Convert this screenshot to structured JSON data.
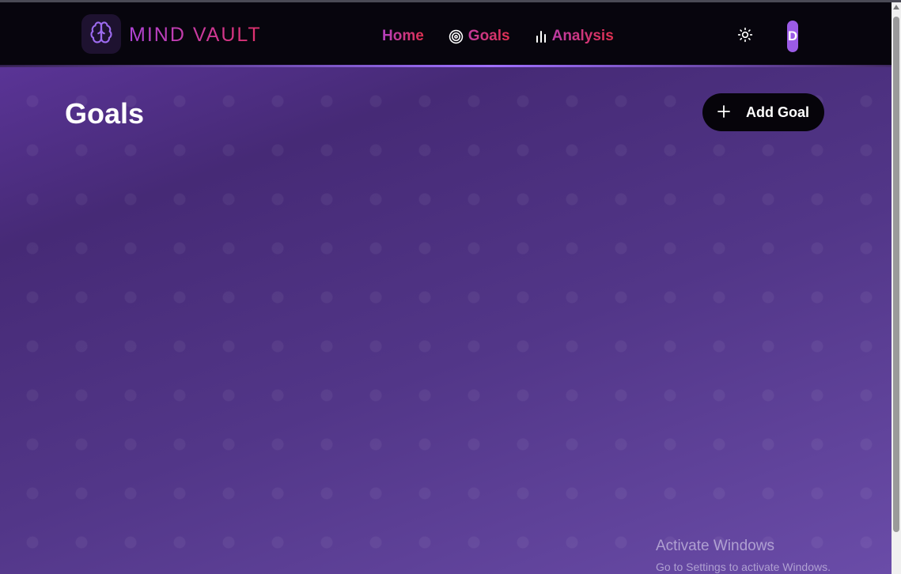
{
  "header": {
    "brand": "MIND VAULT",
    "logo_icon": "brain-icon",
    "nav": [
      {
        "label": "Home",
        "icon": null
      },
      {
        "label": "Goals",
        "icon": "target-icon"
      },
      {
        "label": "Analysis",
        "icon": "bar-chart-icon"
      }
    ],
    "theme_icon": "sun-icon",
    "avatar_initial": "D"
  },
  "main": {
    "title": "Goals",
    "add_button_label": "Add Goal",
    "add_button_icon": "plus-icon"
  },
  "watermark": {
    "title": "Activate Windows",
    "subtitle": "Go to Settings to activate Windows."
  },
  "colors": {
    "nav_background": "#07050d",
    "accent_gradient_start": "#b043d8",
    "accent_gradient_end": "#e0304f",
    "main_background": "#523688",
    "avatar": "#9b5be6"
  }
}
